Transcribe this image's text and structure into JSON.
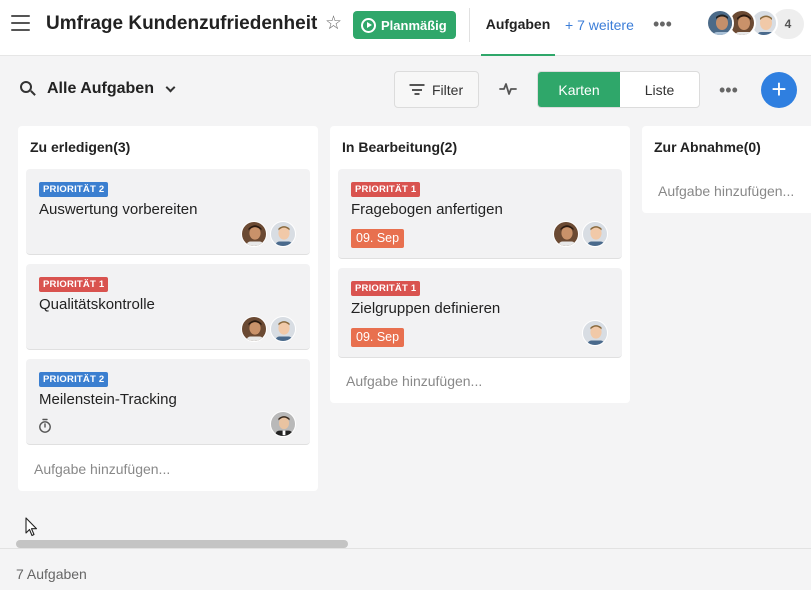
{
  "header": {
    "title": "Umfrage Kundenzufriedenheit",
    "status_label": "Planmäßig",
    "tab_active": "Aufgaben",
    "tab_more": "+ 7 weitere",
    "member_count": "4",
    "status_color": "#2fa76a"
  },
  "toolbar": {
    "view_title": "Alle Aufgaben",
    "filter_label": "Filter",
    "view_cards": "Karten",
    "view_list": "Liste",
    "add_icon": "plus-icon"
  },
  "columns": [
    {
      "title": "Zu erledigen(3)",
      "add_label": "Aufgabe hinzufügen...",
      "cards": [
        {
          "priority": "PRIORITÄT 2",
          "title": "Auswertung vorbereiten"
        },
        {
          "priority": "PRIORITÄT 1",
          "title": "Qualitätskontrolle"
        },
        {
          "priority": "PRIORITÄT 2",
          "title": "Meilenstein-Tracking",
          "icon": "timer-icon"
        }
      ]
    },
    {
      "title": "In Bearbeitung(2)",
      "add_label": "Aufgabe hinzufügen...",
      "cards": [
        {
          "priority": "PRIORITÄT 1",
          "title": "Fragebogen anfertigen",
          "due": "09. Sep"
        },
        {
          "priority": "PRIORITÄT 1",
          "title": "Zielgruppen definieren",
          "due": "09. Sep"
        }
      ]
    },
    {
      "title": "Zur Abnahme(0)",
      "add_label": "Aufgabe hinzufügen..."
    }
  ],
  "footer": {
    "task_count": "7 Aufgaben"
  },
  "colors": {
    "accent": "#2fa76a",
    "priority_1": "#d9534f",
    "priority_2": "#3b7fd0",
    "due_date": "#e8704f",
    "add_button": "#2f7fe0"
  }
}
